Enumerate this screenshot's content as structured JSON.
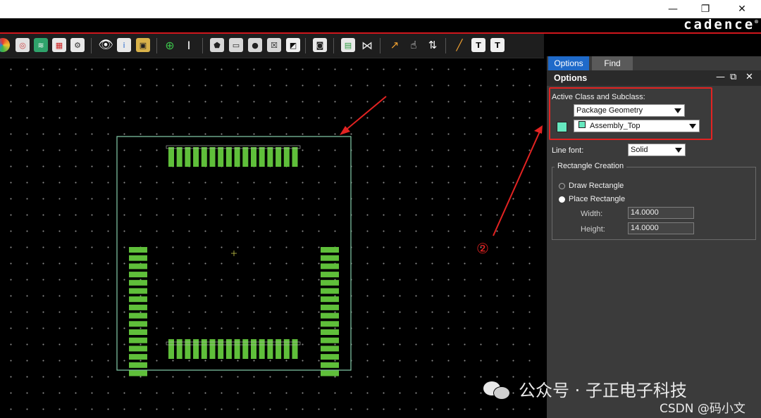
{
  "window": {
    "brand": "cadence",
    "brand_mark": "®",
    "minimize": "—",
    "restore": "❐",
    "close": "✕"
  },
  "toolbar": {
    "icons": [
      "color-wheel-icon",
      "snapshot-icon",
      "layers-icon",
      "spreadsheet-icon",
      "gear-doc-icon",
      "visibility-eye-icon",
      "info-icon",
      "3d-view-icon",
      "add-pin-icon",
      "text-cursor-icon",
      "add-polygon-icon",
      "add-rectangle-icon",
      "add-circle-icon",
      "add-frectangle-icon",
      "shape-fill-icon",
      "camera-icon",
      "report-icon",
      "mirror-icon",
      "route-icon",
      "pointer-icon",
      "swap-icon",
      "line-draw-icon",
      "add-text-icon",
      "edit-text-icon"
    ]
  },
  "canvas": {
    "colors": {
      "outline": "#7bbf9f",
      "pad": "#5fbf3a",
      "arrow": "#e32322",
      "pin_label": "#bcbcbc"
    },
    "callout_number": "②"
  },
  "panel": {
    "tabs": [
      {
        "label": "Options",
        "active": true
      },
      {
        "label": "Find",
        "active": false
      }
    ],
    "title": "Options",
    "minimize": "—",
    "float": "⧉",
    "close": "✕",
    "active_class_label": "Active Class and Subclass:",
    "class_value": "Package Geometry",
    "subclass_value": "Assembly_Top",
    "line_font_label": "Line font:",
    "line_font_value": "Solid",
    "rect_group_title": "Rectangle Creation",
    "draw_rect_label": "Draw Rectangle",
    "place_rect_label": "Place Rectangle",
    "width_label": "Width:",
    "width_value": "14.0000",
    "height_label": "Height:",
    "height_value": "14.0000",
    "selected_mode": "Place Rectangle",
    "colors": {
      "swatch": "#66e8bf",
      "tab_active": "#1f6ac9",
      "tab_inactive": "#5a5a5a"
    }
  },
  "watermark": {
    "wechat": "公众号 · 子正电子科技",
    "csdn": "CSDN @码小文"
  }
}
